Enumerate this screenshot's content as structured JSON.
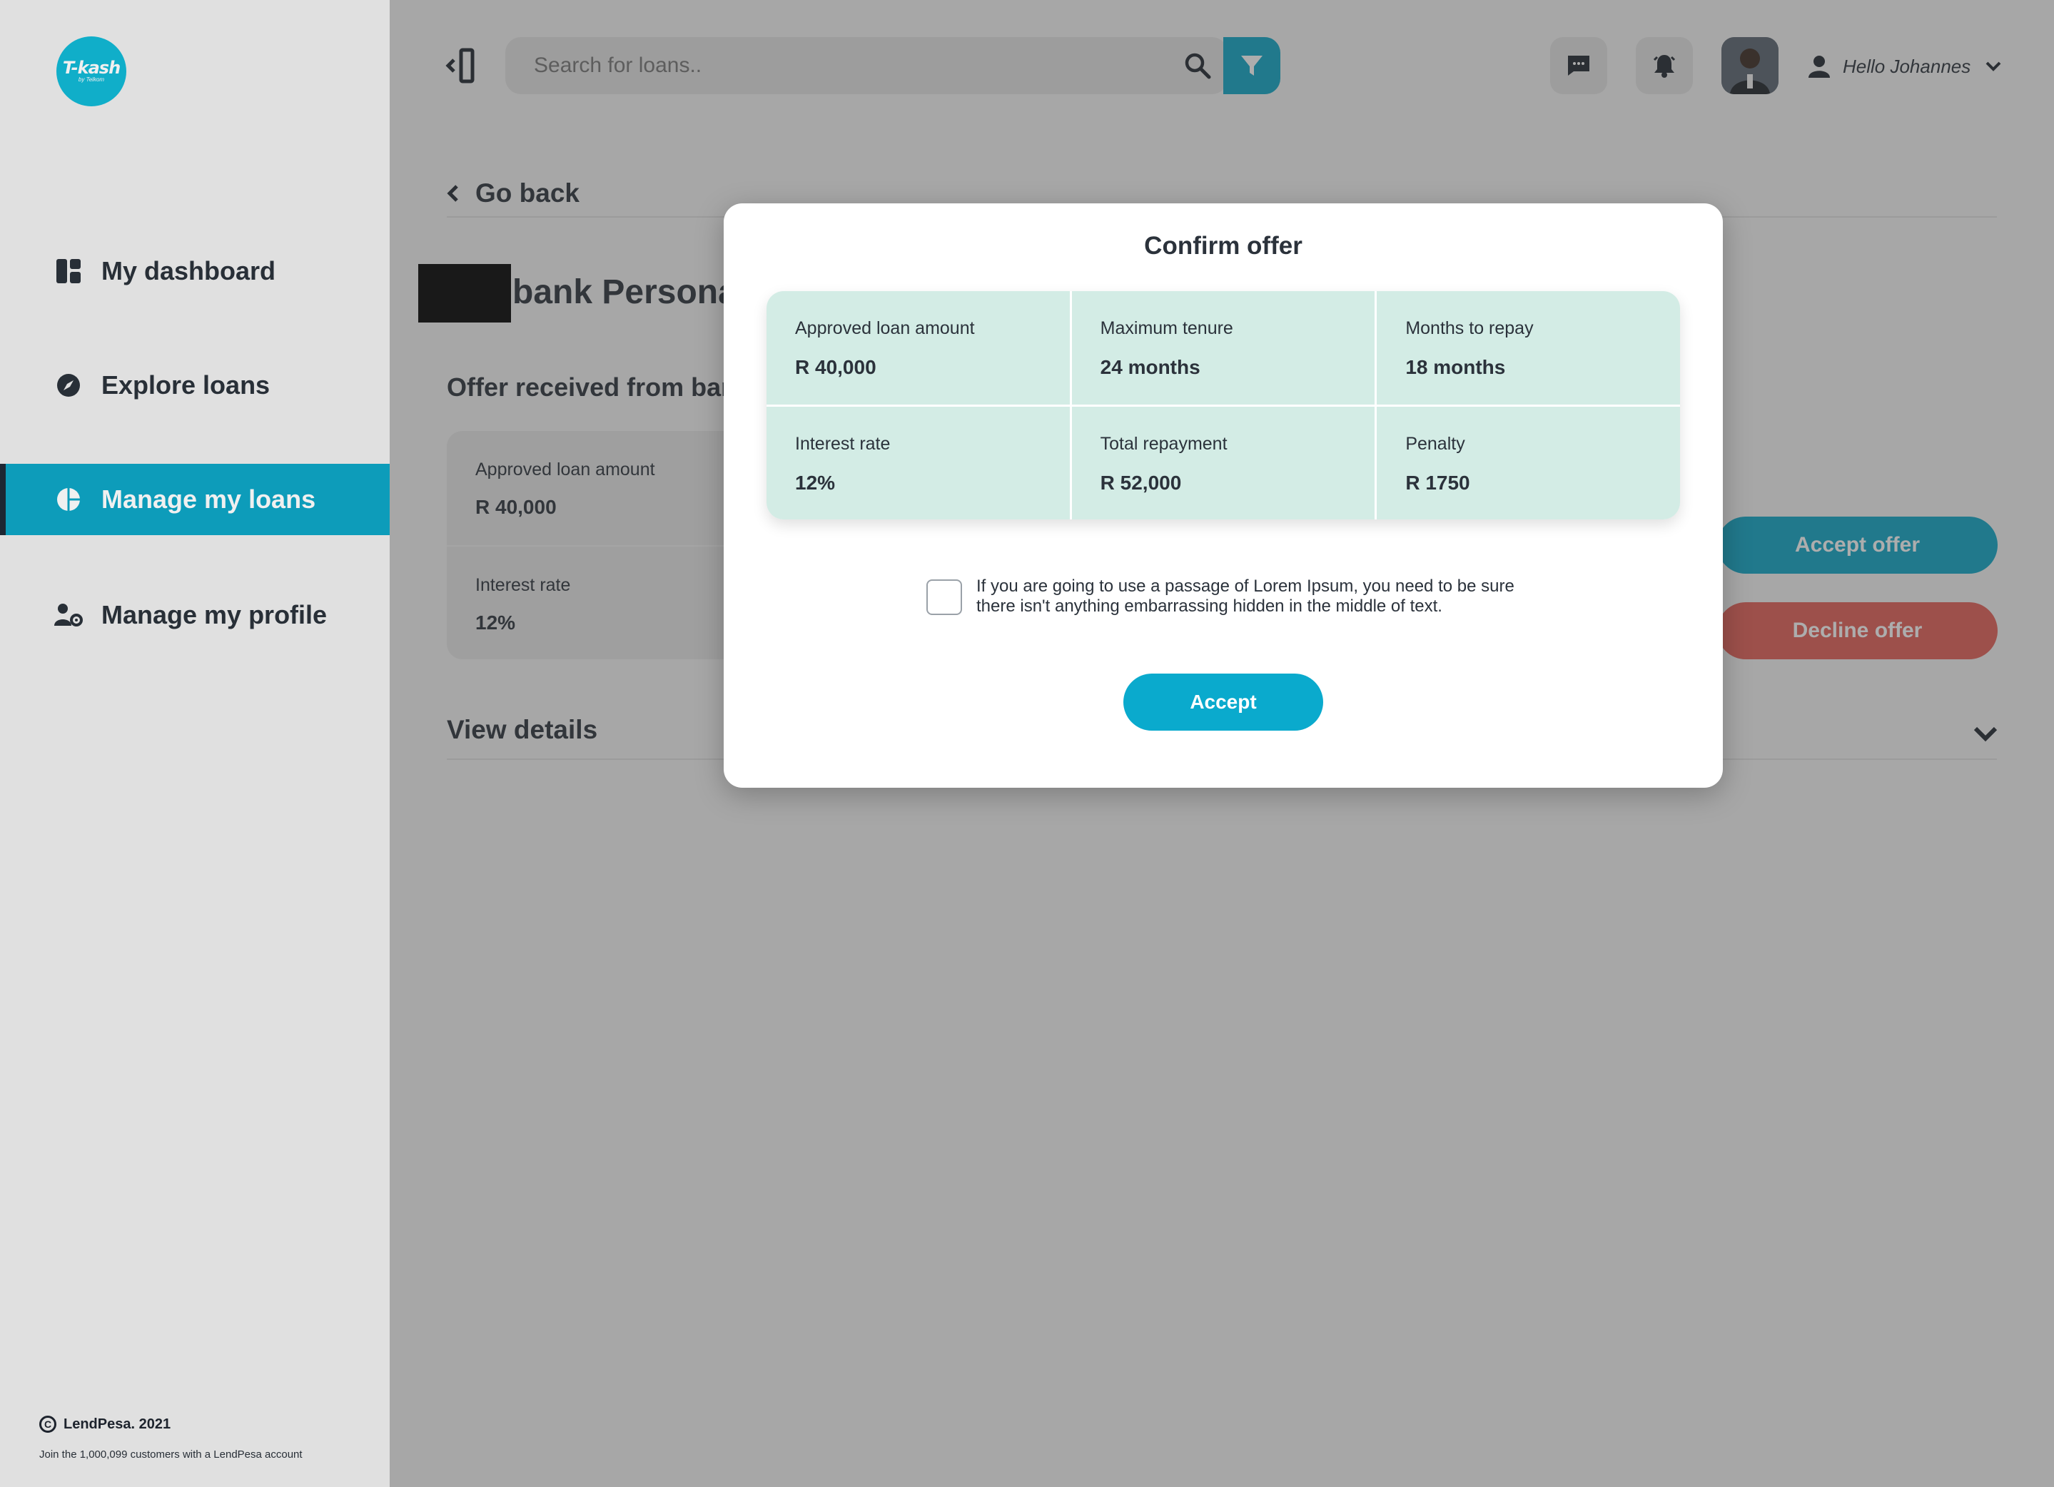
{
  "brand": {
    "logo_text": "T-kash",
    "logo_sub": "by Telkom",
    "accent": "#0ea6c6"
  },
  "sidebar": {
    "items": [
      {
        "label": "My dashboard",
        "icon": "dashboard-icon"
      },
      {
        "label": "Explore loans",
        "icon": "compass-icon"
      },
      {
        "label": "Manage my loans",
        "icon": "pie-chart-icon",
        "active": true
      },
      {
        "label": "Manage my profile",
        "icon": "user-gear-icon"
      }
    ],
    "footer": {
      "copyright": "LendPesa. 2021",
      "tagline": "Join the 1,000,099 customers with a LendPesa account"
    }
  },
  "header": {
    "search": {
      "placeholder": "Search for loans..",
      "value": ""
    },
    "user_greeting": "Hello Johannes"
  },
  "page": {
    "go_back": "Go back",
    "title": "bank Personal",
    "offer_heading": "Offer received from bank",
    "background_card": [
      {
        "label": "Approved loan amount",
        "value": "R 40,000"
      },
      {
        "label": "Interest rate",
        "value": "12%"
      }
    ],
    "accept_offer": "Accept offer",
    "decline_offer": "Decline offer",
    "view_details": "View details"
  },
  "modal": {
    "title": "Confirm offer",
    "cells": [
      {
        "label": "Approved loan amount",
        "value": "R 40,000"
      },
      {
        "label": "Maximum tenure",
        "value": "24 months"
      },
      {
        "label": "Months to repay",
        "value": "18 months"
      },
      {
        "label": "Interest rate",
        "value": "12%"
      },
      {
        "label": "Total repayment",
        "value": "R 52,000"
      },
      {
        "label": "Penalty",
        "value": "R 1750"
      }
    ],
    "consent_text": "If you are going to use a passage of Lorem Ipsum, you need to be sure there isn't anything embarrassing hidden in the middle of text.",
    "consent_checked": false,
    "accept_label": "Accept"
  }
}
